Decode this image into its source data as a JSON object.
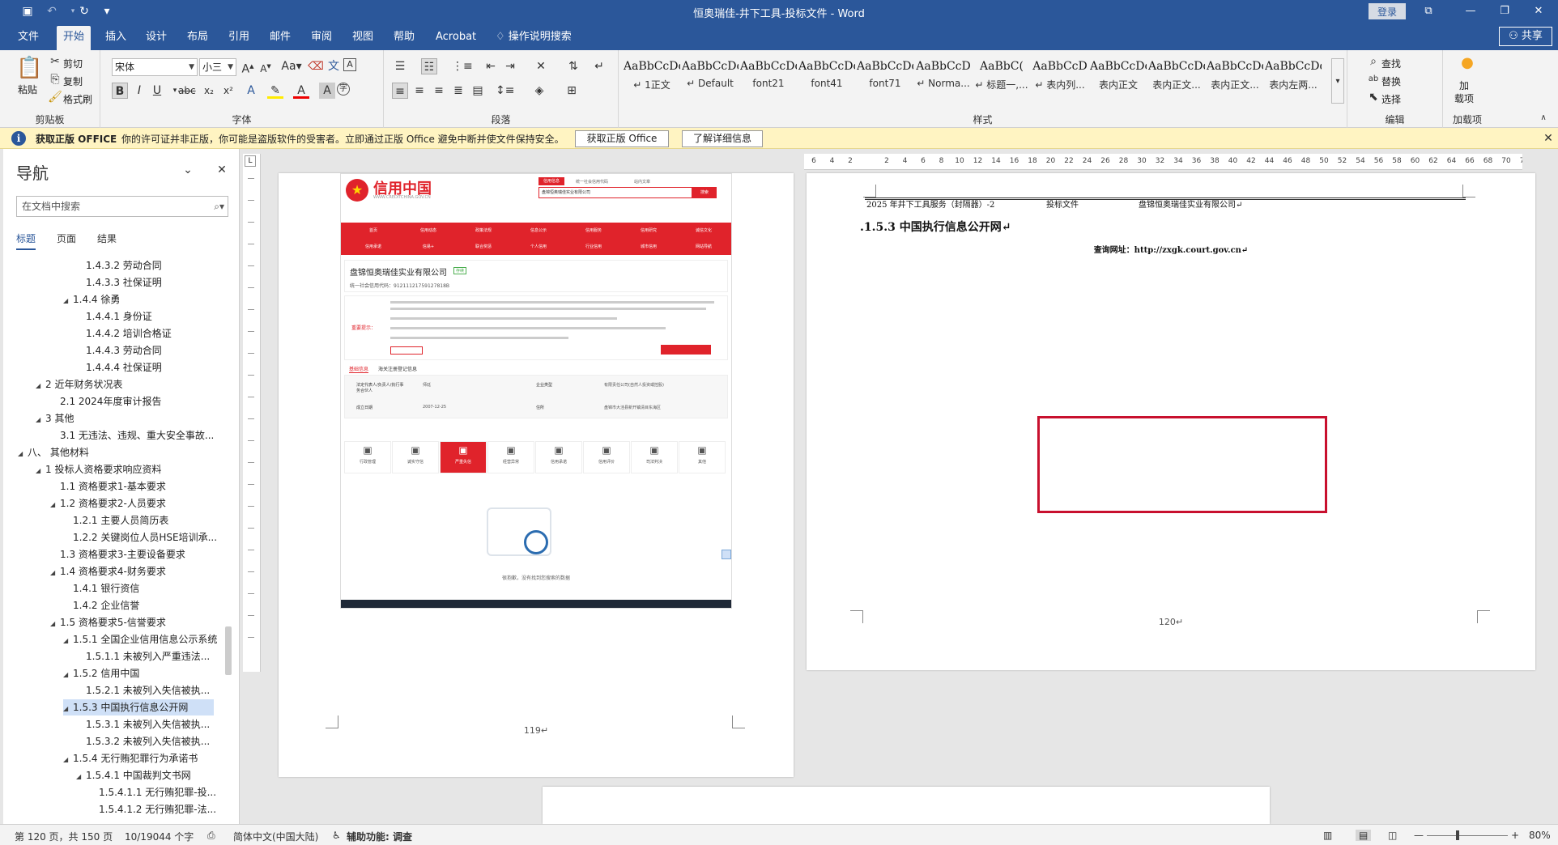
{
  "titlebar": {
    "title": "恒奥瑞佳-井下工具-投标文件 - Word",
    "login": "登录"
  },
  "tabs": [
    "文件",
    "开始",
    "插入",
    "设计",
    "布局",
    "引用",
    "邮件",
    "审阅",
    "视图",
    "帮助",
    "Acrobat",
    "操作说明搜索"
  ],
  "share": "共享",
  "ribbon": {
    "clipboard": {
      "label": "剪贴板",
      "paste": "粘贴",
      "cut": "剪切",
      "copy": "复制",
      "format_painter": "格式刷"
    },
    "font": {
      "label": "字体",
      "family": "宋体",
      "size": "小三"
    },
    "paragraph": {
      "label": "段落"
    },
    "styles": {
      "label": "样式",
      "items": [
        {
          "preview": "AaBbCcDc",
          "name": "↵ 1正文"
        },
        {
          "preview": "AaBbCcDc",
          "name": "↵ Default"
        },
        {
          "preview": "AaBbCcDdE",
          "name": "font21"
        },
        {
          "preview": "AaBbCcDc",
          "name": "font41"
        },
        {
          "preview": "AaBbCcDdEe",
          "name": "font71"
        },
        {
          "preview": "AaBbCcD",
          "name": "↵ Norma..."
        },
        {
          "preview": "AaBbC(",
          "name": "↵ 标题一,..."
        },
        {
          "preview": "AaBbCcD",
          "name": "↵ 表内列..."
        },
        {
          "preview": "AaBbCcDc",
          "name": "表内正文"
        },
        {
          "preview": "AaBbCcDdI",
          "name": "表内正文..."
        },
        {
          "preview": "AaBbCcDc",
          "name": "表内正文..."
        },
        {
          "preview": "AaBbCcDdI",
          "name": "表内左两..."
        }
      ]
    },
    "editing": {
      "label": "编辑",
      "find": "查找",
      "replace": "替换",
      "select": "选择"
    },
    "addins": {
      "label": "加载项",
      "btn": "加\n载项"
    }
  },
  "msgbar": {
    "title": "获取正版 OFFICE",
    "text": "你的许可证并非正版，你可能是盗版软件的受害者。立即通过正版 Office 避免中断并使文件保持安全。",
    "btn1": "获取正版 Office",
    "btn2": "了解详细信息"
  },
  "nav": {
    "title": "导航",
    "search_placeholder": "在文档中搜索",
    "tabs": [
      "标题",
      "页面",
      "结果"
    ],
    "items": [
      {
        "text": "1.4.3.2 劳动合同",
        "level": 4,
        "tri": ""
      },
      {
        "text": "1.4.3.3 社保证明",
        "level": 4,
        "tri": ""
      },
      {
        "text": "1.4.4 徐勇",
        "level": 3,
        "tri": "◢"
      },
      {
        "text": "1.4.4.1 身份证",
        "level": 4,
        "tri": ""
      },
      {
        "text": "1.4.4.2 培训合格证",
        "level": 4,
        "tri": ""
      },
      {
        "text": "1.4.4.3 劳动合同",
        "level": 4,
        "tri": ""
      },
      {
        "text": "1.4.4.4 社保证明",
        "level": 4,
        "tri": ""
      },
      {
        "text": "2 近年财务状况表",
        "level": 1,
        "tri": "◢"
      },
      {
        "text": "2.1 2024年度审计报告",
        "level": 2,
        "tri": ""
      },
      {
        "text": "3 其他",
        "level": 1,
        "tri": "◢"
      },
      {
        "text": "3.1 无违法、违规、重大安全事故...",
        "level": 2,
        "tri": ""
      },
      {
        "text": "八、 其他材料",
        "level": 0,
        "tri": "◢"
      },
      {
        "text": "1 投标人资格要求响应资料",
        "level": 1,
        "tri": "◢"
      },
      {
        "text": "1.1 资格要求1-基本要求",
        "level": 2,
        "tri": ""
      },
      {
        "text": "1.2 资格要求2-人员要求",
        "level": 2,
        "tri": "◢"
      },
      {
        "text": "1.2.1 主要人员简历表",
        "level": 3,
        "tri": ""
      },
      {
        "text": "1.2.2 关键岗位人员HSE培训承...",
        "level": 3,
        "tri": ""
      },
      {
        "text": "1.3 资格要求3-主要设备要求",
        "level": 2,
        "tri": ""
      },
      {
        "text": "1.4 资格要求4-财务要求",
        "level": 2,
        "tri": "◢"
      },
      {
        "text": "1.4.1 银行资信",
        "level": 3,
        "tri": ""
      },
      {
        "text": "1.4.2 企业信誉",
        "level": 3,
        "tri": ""
      },
      {
        "text": "1.5 资格要求5-信誉要求",
        "level": 2,
        "tri": "◢"
      },
      {
        "text": "1.5.1 全国企业信用信息公示系统",
        "level": 3,
        "tri": "◢"
      },
      {
        "text": "1.5.1.1 未被列入严重违法...",
        "level": 4,
        "tri": ""
      },
      {
        "text": "1.5.2 信用中国",
        "level": 3,
        "tri": "◢"
      },
      {
        "text": "1.5.2.1 未被列入失信被执...",
        "level": 4,
        "tri": ""
      },
      {
        "text": "1.5.3 中国执行信息公开网",
        "level": 3,
        "tri": "◢",
        "selected": true
      },
      {
        "text": "1.5.3.1 未被列入失信被执...",
        "level": 4,
        "tri": ""
      },
      {
        "text": "1.5.3.2 未被列入失信被执...",
        "level": 4,
        "tri": ""
      },
      {
        "text": "1.5.4 无行贿犯罪行为承诺书",
        "level": 3,
        "tri": "◢"
      },
      {
        "text": "1.5.4.1 中国裁判文书网",
        "level": 4,
        "tri": "◢"
      },
      {
        "text": "1.5.4.1.1 无行贿犯罪-投...",
        "level": 5,
        "tri": ""
      },
      {
        "text": "1.5.4.1.2 无行贿犯罪-法...",
        "level": 5,
        "tri": ""
      }
    ]
  },
  "page119": {
    "page_number": "119↵",
    "site": {
      "logo": "信用中国",
      "logo_sub": "WWW.CREDITCHINA.GOV.CN",
      "tab1": "信用信息",
      "tab2": "统一社会信用代码",
      "tab3": "站内文章",
      "search_value": "盘锦恒奥瑞佳实业有限公司",
      "search_btn": "搜索",
      "nav1": [
        "首页",
        "信用动态",
        "政策法规",
        "信息公示",
        "信用服务",
        "信用研究",
        "诚信文化"
      ],
      "nav2": [
        "信用承诺",
        "信易+",
        "联合奖惩",
        "个人信用",
        "行业信用",
        "城市信用",
        "网站导航"
      ],
      "company": "盘锦恒奥瑞佳实业有限公司",
      "status": "存续",
      "code": "统一社会信用代码：91211121759127818B",
      "notice_label": "重要提示：",
      "tabs": [
        "基础信息",
        "海关注册登记信息"
      ],
      "fields": [
        [
          "法定代表人/负责人/执行事务合伙人",
          "师廷",
          "企业类型",
          "有限责任公司(自然人投资或控股)"
        ],
        [
          "成立日期",
          "2007-12-25",
          "住所",
          "盘锦市大洼县新开镇清目东海区"
        ]
      ],
      "cats": [
        "行政管理",
        "诚实守信",
        "严重失信",
        "经营异常",
        "信用承诺",
        "信用评价",
        "司法判决",
        "其他"
      ],
      "empty": "很抱歉，没有找到您搜索的数据"
    }
  },
  "page120": {
    "header_left": "2025 年井下工具服务（封隔器）-2",
    "header_mid": "投标文件",
    "header_right": "盘锦恒奥瑞佳实业有限公司↵",
    "heading": ".1.5.3 中国执行信息公开网↵",
    "query": "查询网址：http://zxgk.court.gov.cn↵",
    "page_number": "120↵"
  },
  "ruler_ticks": [
    "6",
    "4",
    "2",
    "",
    "2",
    "4",
    "6",
    "8",
    "10",
    "12",
    "14",
    "16",
    "18",
    "20",
    "22",
    "24",
    "26",
    "28",
    "30",
    "32",
    "34",
    "36",
    "38",
    "40",
    "42",
    "44",
    "46",
    "48",
    "50",
    "52",
    "54",
    "56",
    "58",
    "60",
    "62",
    "64",
    "66",
    "68",
    "70",
    "72"
  ],
  "status": {
    "page": "第 120 页，共 150 页",
    "words": "10/19044 个字",
    "lang": "简体中文(中国大陆)",
    "access": "辅助功能: 调查",
    "zoom": "80%"
  },
  "colors": {
    "word_blue": "#2b579a",
    "credit_red": "#e0232b",
    "highlight_red": "#c8102e"
  }
}
